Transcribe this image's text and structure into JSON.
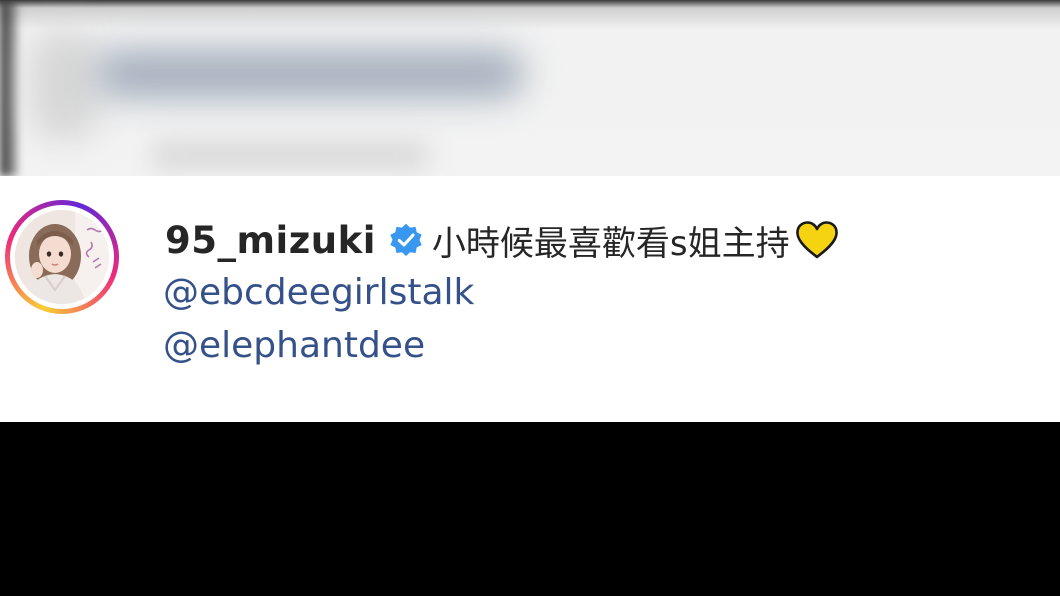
{
  "post": {
    "username": "95_mizuki",
    "verified": true,
    "caption": "小時候最喜歡看s姐主持",
    "caption_emoji": "yellow-heart-icon",
    "mentions": [
      "@ebcdeegirlstalk",
      "@elephantdee"
    ]
  },
  "colors": {
    "username": "#262626",
    "mention": "#35518a",
    "verified_badge": "#3897f0",
    "heart": "#f5d310",
    "background": "#ffffff",
    "letterbox": "#000000"
  },
  "icons": {
    "verified": "verified-badge-icon",
    "heart": "yellow-heart-icon",
    "avatar": "profile-picture"
  }
}
